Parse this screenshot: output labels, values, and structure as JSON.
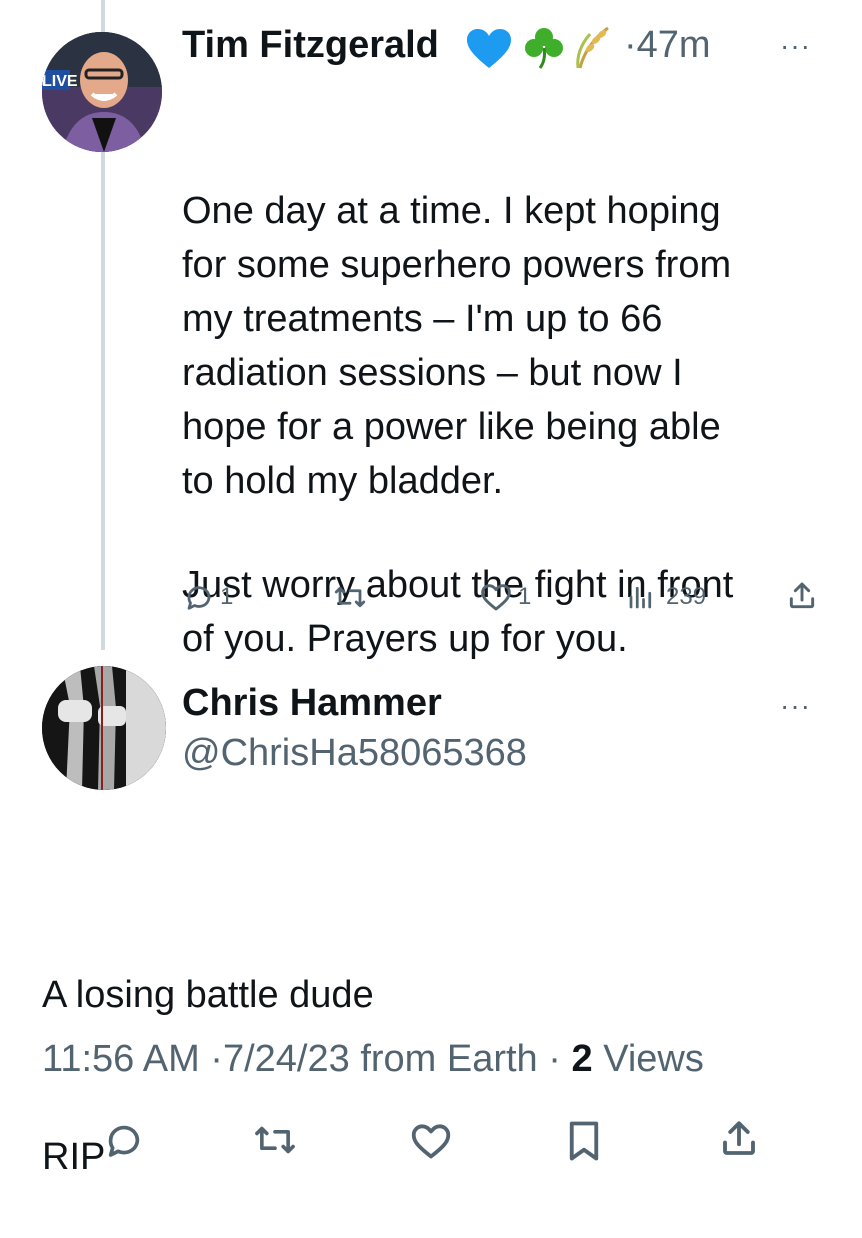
{
  "reply_tweet": {
    "author_name": "Tim Fitzgerald",
    "avatar_text": "LIVE",
    "separator": "·",
    "time_ago": "47m",
    "more": "···",
    "paragraph_1": "One day at a time. I kept hoping\nfor some superhero powers from\nmy treatments – I'm up to 66\nradiation sessions – but now I\nhope for a power like being able\nto hold my bladder.",
    "paragraph_2": "Just worry about the fight in front\nof you. Prayers up for you.",
    "replies": "1",
    "likes": "1",
    "views": "239",
    "icons": [
      "blue-heart-icon",
      "shamrock-icon",
      "wheat-icon",
      "reply-icon",
      "retweet-icon",
      "like-icon",
      "views-icon",
      "share-icon"
    ]
  },
  "main_tweet": {
    "author_name": "Chris Hammer",
    "handle": "@ChrisHa58065368",
    "more": "···",
    "line_1": "A losing battle dude",
    "line_2": "RIP",
    "time": "11:56 AM",
    "date": "7/24/23",
    "source": "from Earth",
    "views_count": "2",
    "views_label": "Views",
    "separator": "·",
    "icons": [
      "reply-icon",
      "retweet-icon",
      "like-icon",
      "bookmark-icon",
      "share-icon"
    ]
  },
  "colors": {
    "text": "#0f1419",
    "secondary": "#536471",
    "thread_line": "#cfd9de",
    "verified_heart": "#1d9bf0"
  }
}
